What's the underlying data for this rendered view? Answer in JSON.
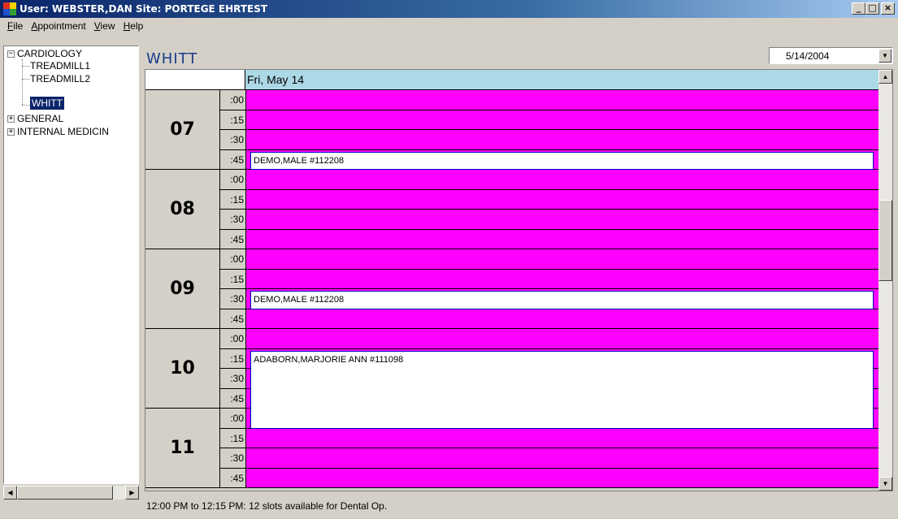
{
  "window": {
    "title": "User: WEBSTER,DAN Site: PORTEGE EHRTEST",
    "minimize_glyph": "_",
    "maximize_glyph": "□",
    "close_glyph": "×"
  },
  "menu": {
    "file": {
      "accel": "F",
      "rest": "ile"
    },
    "appointment": {
      "accel": "A",
      "rest": "ppointment"
    },
    "view": {
      "accel": "V",
      "rest": "iew"
    },
    "help": {
      "accel": "H",
      "rest": "elp"
    }
  },
  "tree": {
    "cardiology": {
      "label": "CARDIOLOGY",
      "expander": "−"
    },
    "treadmill1": "TREADMILL1",
    "treadmill2": "TREADMILL2",
    "whitt": "WHITT",
    "general": {
      "label": "GENERAL",
      "expander": "+"
    },
    "internal_medicine": {
      "label": "INTERNAL MEDICIN",
      "expander": "+"
    }
  },
  "resource_title": "WHITT",
  "date_selector": {
    "value": "5/14/2004"
  },
  "calendar": {
    "day_header": "Fri, May 14",
    "hours": [
      "07",
      "08",
      "09",
      "10",
      "11"
    ],
    "minutes": [
      ":00",
      ":15",
      ":30",
      ":45"
    ],
    "appointments": [
      {
        "patient": "DEMO,MALE #112208",
        "start": "07:45"
      },
      {
        "patient": "DEMO,MALE #112208",
        "start": "09:30"
      },
      {
        "patient": "ADABORN,MARJORIE ANN #111098",
        "start": "10:15"
      }
    ]
  },
  "status": "12:00 PM to 12:15 PM: 12 slots available for Dental Op.",
  "colors": {
    "slot_available": "#ff00ff",
    "header": "#add8e6",
    "appointment": "#ffffff",
    "selection": "#0a246a"
  }
}
